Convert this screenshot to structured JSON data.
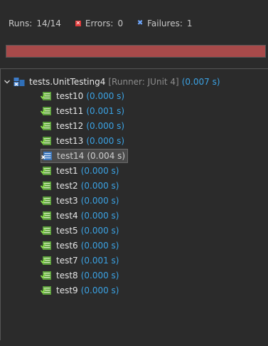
{
  "summary": {
    "runs_label": "Runs:",
    "runs_value": "14/14",
    "errors_label": "Errors:",
    "errors_value": "0",
    "failures_label": "Failures:",
    "failures_value": "1"
  },
  "progress": {
    "status": "failed",
    "fraction": 1.0,
    "color": "#a84a4a"
  },
  "suite": {
    "name": "tests.UnitTesting4",
    "runner": "[Runner: JUnit 4]",
    "time": "(0.007 s)"
  },
  "tests": [
    {
      "name": "test10",
      "time": "(0.000 s)",
      "status": "pass"
    },
    {
      "name": "test11",
      "time": "(0.001 s)",
      "status": "pass"
    },
    {
      "name": "test12",
      "time": "(0.000 s)",
      "status": "pass"
    },
    {
      "name": "test13",
      "time": "(0.000 s)",
      "status": "pass"
    },
    {
      "name": "test14",
      "time": "(0.004 s)",
      "status": "fail"
    },
    {
      "name": "test1",
      "time": "(0.000 s)",
      "status": "pass"
    },
    {
      "name": "test2",
      "time": "(0.000 s)",
      "status": "pass"
    },
    {
      "name": "test3",
      "time": "(0.000 s)",
      "status": "pass"
    },
    {
      "name": "test4",
      "time": "(0.000 s)",
      "status": "pass"
    },
    {
      "name": "test5",
      "time": "(0.000 s)",
      "status": "pass"
    },
    {
      "name": "test6",
      "time": "(0.000 s)",
      "status": "pass"
    },
    {
      "name": "test7",
      "time": "(0.001 s)",
      "status": "pass"
    },
    {
      "name": "test8",
      "time": "(0.000 s)",
      "status": "pass"
    },
    {
      "name": "test9",
      "time": "(0.000 s)",
      "status": "pass"
    }
  ],
  "icons": {
    "pass": "test-pass-icon",
    "fail": "test-fail-icon",
    "suite": "suite-fail-icon"
  }
}
